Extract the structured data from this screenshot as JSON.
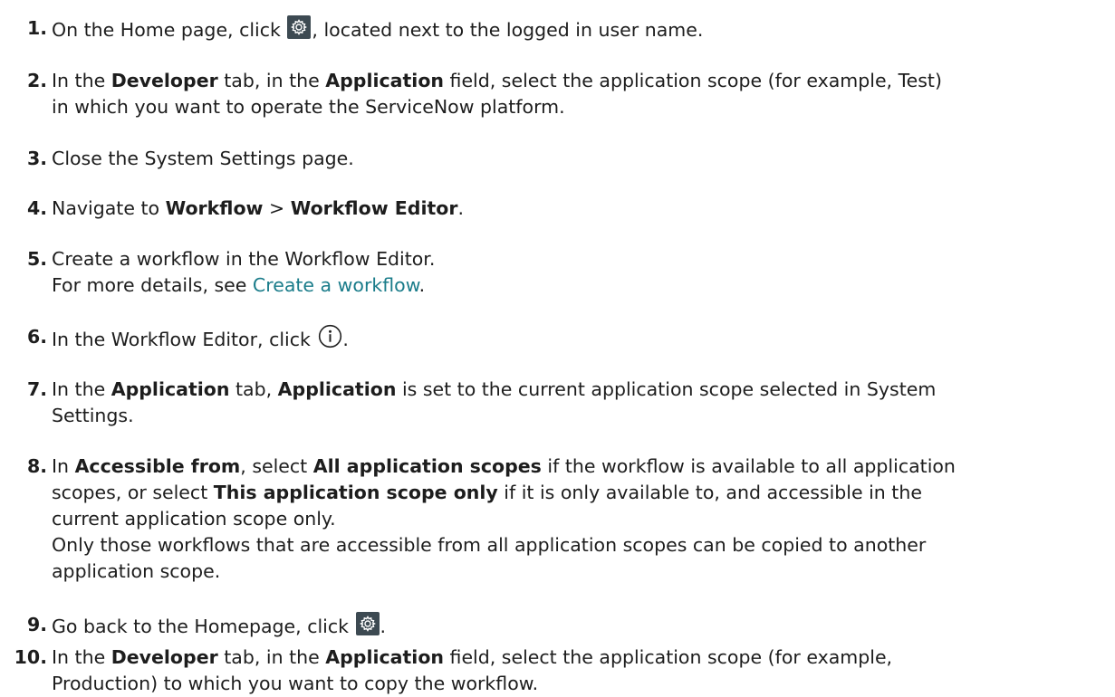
{
  "steps": [
    {
      "num": "1.",
      "a": "On the Home page, click ",
      "icon": "gear-icon",
      "b": ", located next to the logged in user name."
    },
    {
      "num": "2.",
      "a": "In the ",
      "bold1": "Developer",
      "b": " tab, in the ",
      "bold2": "Application",
      "c": " field, select the application scope (for example, Test)",
      "line2": "in which you want to operate the ServiceNow platform."
    },
    {
      "num": "3.",
      "a": "Close the System Settings page."
    },
    {
      "num": "4.",
      "a": "Navigate to ",
      "bold1": "Workflow",
      "b": " > ",
      "bold2": "Workflow Editor",
      "c": "."
    },
    {
      "num": "5.",
      "a": "Create a workflow in the Workflow Editor.",
      "line2a": "For more details, see ",
      "link": "Create a workflow",
      "line2b": "."
    },
    {
      "num": "6.",
      "a": "In the Workflow Editor, click ",
      "icon": "info-icon",
      "b": "."
    },
    {
      "num": "7.",
      "a": "In the ",
      "bold1": "Application",
      "b": " tab, ",
      "bold2": "Application",
      "c": " is set to the current application scope selected in System",
      "line2": "Settings."
    },
    {
      "num": "8.",
      "a": "In ",
      "bold1": "Accessible from",
      "b": ", select ",
      "bold2": "All application scopes",
      "c": " if the workflow is available to all application",
      "line2a": "scopes, or select ",
      "bold3": "This application scope only",
      "line2b": " if it is only available to, and accessible in the",
      "line3": "current application scope only.",
      "line4": "Only those workflows that are accessible from all application scopes can be copied to another",
      "line5": "application scope."
    },
    {
      "num": "9.",
      "a": "Go back to the Homepage, click ",
      "icon": "gear-icon",
      "b": "."
    },
    {
      "num": "10.",
      "a": "In the ",
      "bold1": "Developer",
      "b": " tab, in the ",
      "bold2": "Application",
      "c": " field, select the application scope (for example,",
      "line2": "Production) to which you want to copy the workflow."
    }
  ]
}
